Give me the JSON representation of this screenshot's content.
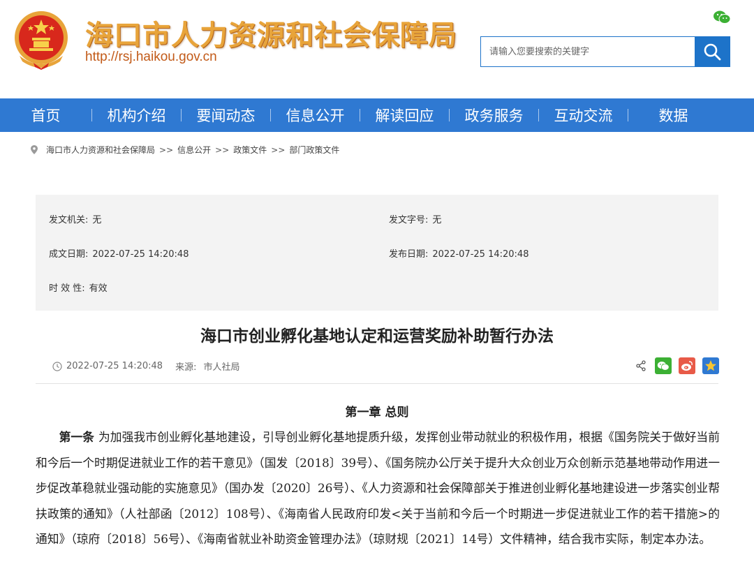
{
  "header": {
    "site_title": "海口市人力资源和社会保障局",
    "site_url": "http://rsj.haikou.gov.cn",
    "emblem_icon": "national-emblem-icon",
    "wechat_icon": "wechat-icon"
  },
  "search": {
    "placeholder": "请输入您要搜索的关键字",
    "button_icon": "search-icon"
  },
  "nav": {
    "items": [
      "首页",
      "机构介绍",
      "要闻动态",
      "信息公开",
      "解读回应",
      "政务服务",
      "互动交流",
      "数据"
    ]
  },
  "breadcrumb": {
    "items": [
      "海口市人力资源和社会保障局",
      "信息公开",
      "政策文件",
      "部门政策文件"
    ],
    "separator": ">>"
  },
  "meta": {
    "issuer_label": "发文机关:",
    "issuer_value": "无",
    "doc_no_label": "发文字号:",
    "doc_no_value": "无",
    "written_date_label": "成文日期:",
    "written_date_value": "2022-07-25 14:20:48",
    "publish_date_label": "发布日期:",
    "publish_date_value": "2022-07-25 14:20:48",
    "validity_label": "时 效 性:",
    "validity_value": "有效"
  },
  "article": {
    "title": "海口市创业孵化基地认定和运营奖励补助暂行办法",
    "date": "2022-07-25 14:20:48",
    "source_label": "来源:",
    "source_value": "市人社局",
    "chapter": "第一章  总则",
    "para_lead": "第一条",
    "para_text": "为加强我市创业孵化基地建设，引导创业孵化基地提质升级，发挥创业带动就业的积极作用，根据《国务院关于做好当前和今后一个时期促进就业工作的若干意见》（国发〔2018〕39号）、《国务院办公厅关于提升大众创业万众创新示范基地带动作用进一步促改革稳就业强动能的实施意见》（国办发〔2020〕26号）、《人力资源和社会保障部关于推进创业孵化基地建设进一步落实创业帮扶政策的通知》（人社部函〔2012〕108号）、《海南省人民政府印发<关于当前和今后一个时期进一步促进就业工作的若干措施>的通知》（琼府〔2018〕56号）、《海南省就业补助资金管理办法》（琼财规〔2021〕14号）文件精神，结合我市实际，制定本办法。"
  },
  "colors": {
    "nav_blue": "#2f79d2",
    "title_gold": "#e8a43a",
    "url_orange": "#c25a18",
    "meta_bg": "#f3f3f3"
  }
}
